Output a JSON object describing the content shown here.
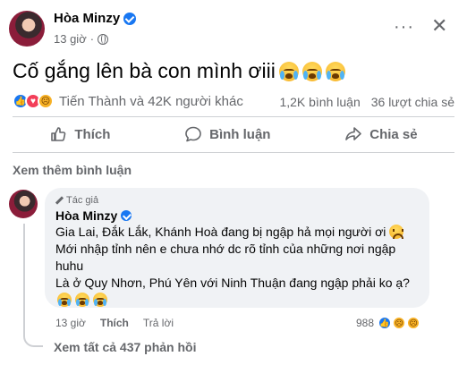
{
  "post": {
    "author": "Hòa Minzy",
    "time": "13 giờ",
    "text": "Cố gắng lên bà con mình ơiii",
    "reactions_text": "Tiến Thành và 42K người khác",
    "comments_count": "1,2K bình luận",
    "shares_count": "36 lượt chia sẻ"
  },
  "actions": {
    "like": "Thích",
    "comment": "Bình luận",
    "share": "Chia sẻ"
  },
  "see_more_comments": "Xem thêm bình luận",
  "comment": {
    "author_badge": "Tác giả",
    "author": "Hòa Minzy",
    "lines": [
      "Gia Lai, Đắk Lắk, Khánh Hoà đang bị ngập hả mọi người ơi",
      "Mới nhập tỉnh nên e chưa nhớ dc rõ tỉnh của những nơi ngập",
      "huhu",
      "Là ở Quy Nhơn, Phú Yên với Ninh Thuận đang ngập phải ko ạ?"
    ],
    "time": "13 giờ",
    "like": "Thích",
    "reply": "Trả lời",
    "reaction_count": "988"
  },
  "view_all_replies": "Xem tất cả 437 phản hồi",
  "icons": {
    "globe": "globe-icon",
    "more": "more-options-icon",
    "close": "close-icon",
    "like": "thumbs-up-icon",
    "comment": "comment-bubble-icon",
    "share": "share-arrow-icon"
  },
  "colors": {
    "brand": "#1877f2",
    "muted": "#65676b",
    "bubble": "#f0f2f5"
  }
}
